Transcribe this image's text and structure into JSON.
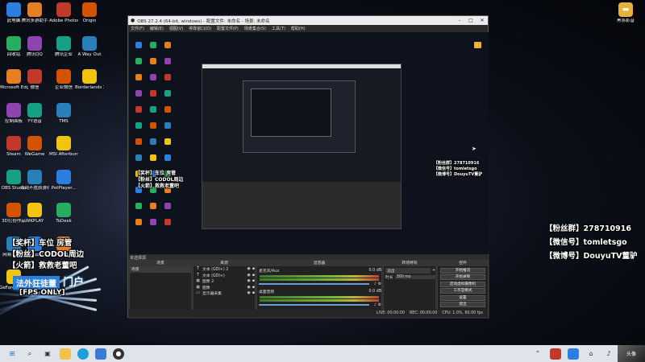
{
  "desktop": {
    "icons_col1": [
      "此电脑",
      "回收站",
      "Microsoft Edge",
      "控制面板",
      "Steam",
      "OBS Studio",
      "3D打扮作品",
      "网易云音乐",
      "GeForce Experience"
    ],
    "icons_col2": [
      "腾讯多游助手",
      "腾讯QQ",
      "微信",
      "YY语音",
      "WeGame",
      "海阔不胜原游戏5.0",
      "WKPLAY",
      "阿里云盘"
    ],
    "icons_col3": [
      "Adobe Photosh...",
      "腾讯企业",
      "企业微信",
      "TMS",
      "MSI Afterburner",
      "PotPlayer...",
      "ToDesk",
      "使命召唤手游"
    ],
    "icons_col4": [
      "Origin",
      "A Way Out",
      "Borderlands 3"
    ],
    "right_icon": "黑系影音"
  },
  "obs": {
    "title": "OBS 27.2.4 (64-bit, windows) - 配置文件: 未命名 - 场景: 未命名",
    "menu": [
      "文件(F)",
      "编辑(E)",
      "视图(V)",
      "停靠窗口(D)",
      "配置文件(P)",
      "场景集合(S)",
      "工具(T)",
      "帮助(H)"
    ],
    "tabs": [
      "场景",
      "来源",
      "混音器",
      "转场特效",
      "控件"
    ],
    "scene": "场景",
    "sources": [
      "文本 (GDI+) 2",
      "文本 (GDI+)",
      "图像 2",
      "图像",
      "显示器采集"
    ],
    "mixer": [
      {
        "name": "麦克风/Aux",
        "db": "0.0 dB"
      },
      {
        "name": "桌面音频",
        "db": "0.0 dB"
      }
    ],
    "transition": {
      "type": "淡出",
      "duration_label": "时长",
      "duration": "300 ms"
    },
    "controls": [
      "开始推流",
      "开始录制",
      "启动虚拟摄像机",
      "工作室模式",
      "设置",
      "退出"
    ],
    "status": {
      "live": "LIVE: 00:00:00",
      "rec": "REC: 00:00:00",
      "cpu": "CPU: 1.0%, 60.00 fps"
    }
  },
  "overlay_right": [
    "【粉丝群】278710916",
    "【微信号】tomletsgo",
    "【微博号】DouyuTV董驴"
  ],
  "overlay_left": [
    "【奖杯】车位  房管",
    "【粉丝】CODOL周边",
    "【火箭】救救老董吧"
  ],
  "overlay_tag": "法外狂徒董",
  "overlay_tag2": "门户",
  "overlay_fps": "[FPS ONLY]",
  "taskbar": {
    "right_text": "头像"
  }
}
